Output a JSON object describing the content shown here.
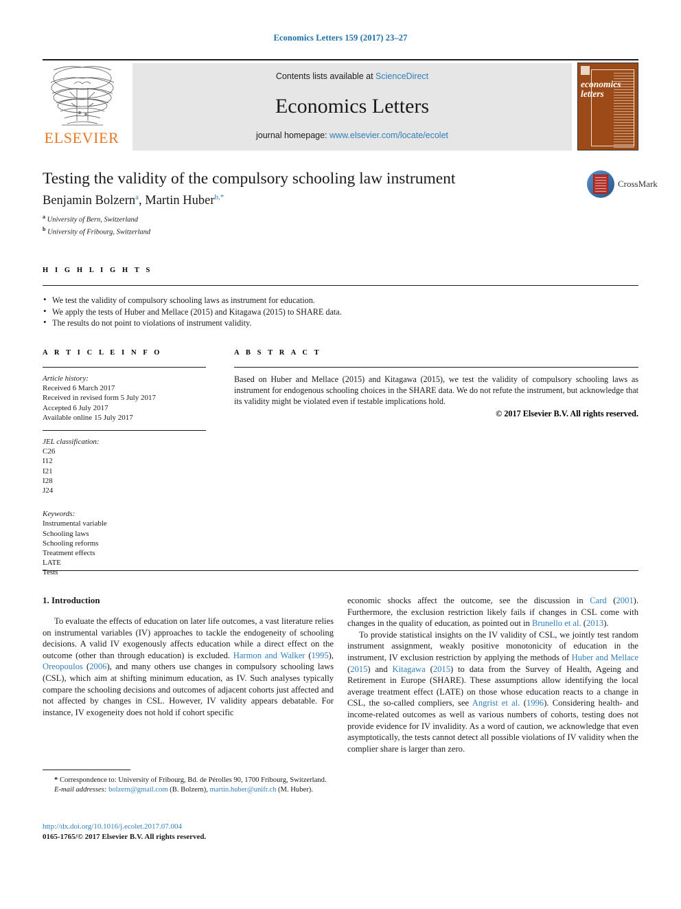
{
  "running_head": "Economics Letters 159 (2017) 23–27",
  "masthead": {
    "contents_prefix": "Contents lists available at ",
    "contents_link": "ScienceDirect",
    "journal_title": "Economics Letters",
    "homepage_prefix": "journal homepage: ",
    "homepage_link": "www.elsevier.com/locate/ecolet",
    "publisher": "ELSEVIER",
    "cover_title": "economics letters"
  },
  "article": {
    "title": "Testing the validity of the compulsory schooling law instrument",
    "authors": [
      {
        "name": "Benjamin Bolzern",
        "marker": "a"
      },
      {
        "name": "Martin Huber",
        "marker": "b,*"
      }
    ],
    "affiliations": [
      {
        "marker": "a",
        "text": "University of Bern, Switzerland"
      },
      {
        "marker": "b",
        "text": "University of Fribourg, Switzerland"
      }
    ],
    "crossmark_label": "CrossMark"
  },
  "highlights": {
    "heading": "H I G H L I G H T S",
    "items": [
      "We test the validity of compulsory schooling laws as instrument for education.",
      "We apply the tests of Huber and Mellace (2015) and Kitagawa (2015) to SHARE data.",
      "The results do not point to violations of instrument validity."
    ]
  },
  "article_info": {
    "heading": "A R T I C L E   I N F O",
    "history_label": "Article history:",
    "history": [
      "Received 6 March 2017",
      "Received in revised form 5 July 2017",
      "Accepted 6 July 2017",
      "Available online 15 July 2017"
    ],
    "jel_label": "JEL classification:",
    "jel_codes": [
      "C26",
      "I12",
      "I21",
      "I28",
      "J24"
    ],
    "keywords_label": "Keywords:",
    "keywords": [
      "Instrumental variable",
      "Schooling laws",
      "Schooling reforms",
      "Treatment effects",
      "LATE",
      "Tests"
    ]
  },
  "abstract": {
    "heading": "A B S T R A C T",
    "text": "Based on Huber and Mellace (2015) and Kitagawa (2015), we test the validity of compulsory schooling laws as instrument for endogenous schooling choices in the SHARE data. We do not refute the instrument, but acknowledge that its validity might be violated even if testable implications hold.",
    "copyright": "© 2017 Elsevier B.V. All rights reserved."
  },
  "body": {
    "section_heading": "1. Introduction",
    "left_paragraph_1": {
      "part1": "To evaluate the effects of education on later life outcomes, a vast literature relies on instrumental variables (IV) approaches to tackle the endogeneity of schooling decisions. A valid IV exogenously affects education while a direct effect on the outcome (other than through education) is excluded. ",
      "ref1": "Harmon and Walker",
      "part2": " (",
      "ref2": "1995",
      "part3": "), ",
      "ref3": "Oreopoulos",
      "part4": " (",
      "ref4": "2006",
      "part5": "), and many others use changes in compulsory schooling laws (CSL), which aim at shifting minimum education, as IV. Such analyses typically compare the schooling decisions and outcomes of adjacent cohorts just affected and not affected by changes in CSL. However, IV validity appears debatable. For instance, IV exogeneity does not hold if cohort specific"
    },
    "right_paragraph_1": {
      "part1": "economic shocks affect the outcome, see the discussion in ",
      "ref1": "Card",
      "part2": " (",
      "ref2": "2001",
      "part3": "). Furthermore, the exclusion restriction likely fails if changes in CSL come with changes in the quality of education, as pointed out in ",
      "ref3": "Brunello et al.",
      "part4": " (",
      "ref4": "2013",
      "part5": ")."
    },
    "right_paragraph_2": {
      "part1": "To provide statistical insights on the IV validity of CSL, we jointly test random instrument assignment, weakly positive monotonicity of education in the instrument, IV exclusion restriction by applying the methods of ",
      "ref1": "Huber and Mellace",
      "part2": " (",
      "ref2": "2015",
      "part3": ") and ",
      "ref3": "Kitagawa",
      "part4": " (",
      "ref4": "2015",
      "part5": ") to data from the Survey of Health, Ageing and Retirement in Europe (SHARE). These assumptions allow identifying the local average treatment effect (LATE) on those whose education reacts to a change in CSL, the so-called compliers, see ",
      "ref5": "Angrist et al.",
      "part6": " (",
      "ref6": "1996",
      "part7": "). Considering health- and income-related outcomes as well as various numbers of cohorts, testing does not provide evidence for IV invalidity. As a word of caution, we acknowledge that even asymptotically, the tests cannot detect all possible violations of IV validity when the complier share is larger than zero."
    }
  },
  "footnotes": {
    "correspondence_marker": "*",
    "correspondence": "Correspondence to: University of Fribourg, Bd. de Pérolles 90, 1700 Fribourg, Switzerland.",
    "email_label": "E-mail addresses:",
    "email1": "bolzern@gmail.com",
    "email1_owner": "(B. Bolzern),",
    "email2": "martin.huber@unifr.ch",
    "email2_owner": "(M. Huber)."
  },
  "doi": {
    "url": "http://dx.doi.org/10.1016/j.ecolet.2017.07.004",
    "rights": "0165-1765/© 2017 Elsevier B.V. All rights reserved."
  },
  "colors": {
    "link": "#2e7eb8",
    "running_head": "#1a6fa8",
    "elsevier_orange": "#E87722",
    "cover_brown": "#9C4A17",
    "masthead_gray": "#e6e6e6"
  }
}
